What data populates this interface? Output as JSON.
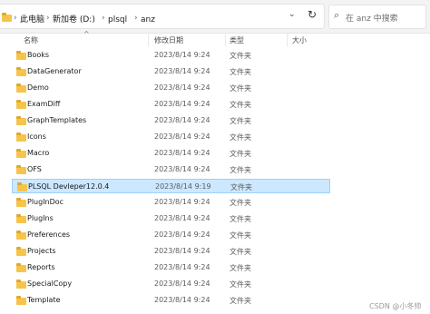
{
  "address_bar": {
    "crumbs": [
      "此电脑",
      "新加卷 (D:)",
      "plsql",
      "anz"
    ],
    "separator": "›",
    "dropdown_icon": "chevron-down",
    "refresh_icon": "refresh",
    "search_placeholder": "在 anz 中搜索"
  },
  "columns": {
    "name": "名称",
    "date": "修改日期",
    "type": "类型",
    "size": "大小",
    "sort_indicator": "^"
  },
  "items": [
    {
      "name": "Books",
      "date": "2023/8/14 9:24",
      "type": "文件夹"
    },
    {
      "name": "DataGenerator",
      "date": "2023/8/14 9:24",
      "type": "文件夹"
    },
    {
      "name": "Demo",
      "date": "2023/8/14 9:24",
      "type": "文件夹"
    },
    {
      "name": "ExamDiff",
      "date": "2023/8/14 9:24",
      "type": "文件夹"
    },
    {
      "name": "GraphTemplates",
      "date": "2023/8/14 9:24",
      "type": "文件夹"
    },
    {
      "name": "Icons",
      "date": "2023/8/14 9:24",
      "type": "文件夹"
    },
    {
      "name": "Macro",
      "date": "2023/8/14 9:24",
      "type": "文件夹"
    },
    {
      "name": "OFS",
      "date": "2023/8/14 9:24",
      "type": "文件夹"
    },
    {
      "name": "PLSQL Devleper12.0.4",
      "date": "2023/8/14 9:19",
      "type": "文件夹",
      "selected": true
    },
    {
      "name": "PlugInDoc",
      "date": "2023/8/14 9:24",
      "type": "文件夹"
    },
    {
      "name": "PlugIns",
      "date": "2023/8/14 9:24",
      "type": "文件夹"
    },
    {
      "name": "Preferences",
      "date": "2023/8/14 9:24",
      "type": "文件夹"
    },
    {
      "name": "Projects",
      "date": "2023/8/14 9:24",
      "type": "文件夹"
    },
    {
      "name": "Reports",
      "date": "2023/8/14 9:24",
      "type": "文件夹"
    },
    {
      "name": "SpecialCopy",
      "date": "2023/8/14 9:24",
      "type": "文件夹"
    },
    {
      "name": "Template",
      "date": "2023/8/14 9:24",
      "type": "文件夹"
    }
  ],
  "watermark": "CSDN @小冬帅",
  "colors": {
    "selection": "#cce8ff",
    "selection_border": "#99d1ff",
    "folder": "#f6c44a"
  }
}
